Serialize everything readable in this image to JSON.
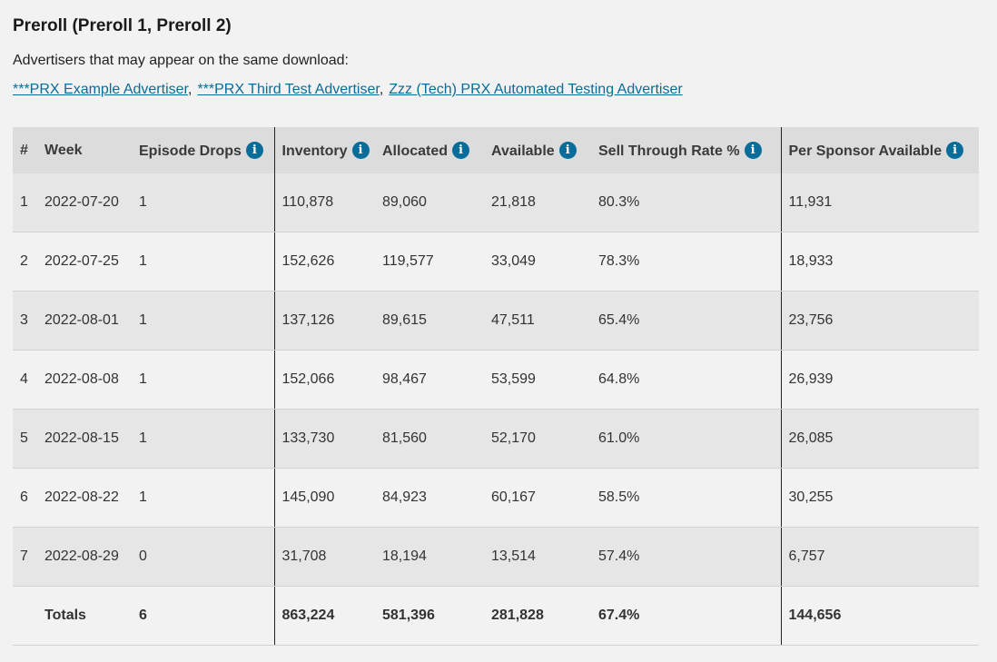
{
  "section_title": "Preroll (Preroll 1, Preroll 2)",
  "advertisers_label": "Advertisers that may appear on the same download:",
  "advertisers": [
    "***PRX Example Advertiser",
    "***PRX Third Test Advertiser",
    "Zzz (Tech) PRX Automated Testing Advertiser"
  ],
  "columns": {
    "num": "#",
    "week": "Week",
    "episode_drops": "Episode Drops",
    "inventory": "Inventory",
    "allocated": "Allocated",
    "available": "Available",
    "sell_through": "Sell Through Rate %",
    "per_sponsor": "Per Sponsor Available"
  },
  "info_icon_glyph": "i",
  "info_icon_color": "#0a6c98",
  "rows": [
    {
      "num": "1",
      "week": "2022-07-20",
      "drops": "1",
      "inventory": "110,878",
      "allocated": "89,060",
      "available": "21,818",
      "sell_through": "80.3%",
      "per_sponsor": "11,931"
    },
    {
      "num": "2",
      "week": "2022-07-25",
      "drops": "1",
      "inventory": "152,626",
      "allocated": "119,577",
      "available": "33,049",
      "sell_through": "78.3%",
      "per_sponsor": "18,933"
    },
    {
      "num": "3",
      "week": "2022-08-01",
      "drops": "1",
      "inventory": "137,126",
      "allocated": "89,615",
      "available": "47,511",
      "sell_through": "65.4%",
      "per_sponsor": "23,756"
    },
    {
      "num": "4",
      "week": "2022-08-08",
      "drops": "1",
      "inventory": "152,066",
      "allocated": "98,467",
      "available": "53,599",
      "sell_through": "64.8%",
      "per_sponsor": "26,939"
    },
    {
      "num": "5",
      "week": "2022-08-15",
      "drops": "1",
      "inventory": "133,730",
      "allocated": "81,560",
      "available": "52,170",
      "sell_through": "61.0%",
      "per_sponsor": "26,085"
    },
    {
      "num": "6",
      "week": "2022-08-22",
      "drops": "1",
      "inventory": "145,090",
      "allocated": "84,923",
      "available": "60,167",
      "sell_through": "58.5%",
      "per_sponsor": "30,255"
    },
    {
      "num": "7",
      "week": "2022-08-29",
      "drops": "0",
      "inventory": "31,708",
      "allocated": "18,194",
      "available": "13,514",
      "sell_through": "57.4%",
      "per_sponsor": "6,757"
    }
  ],
  "totals": {
    "label": "Totals",
    "drops": "6",
    "inventory": "863,224",
    "allocated": "581,396",
    "available": "281,828",
    "sell_through": "67.4%",
    "per_sponsor": "144,656"
  }
}
